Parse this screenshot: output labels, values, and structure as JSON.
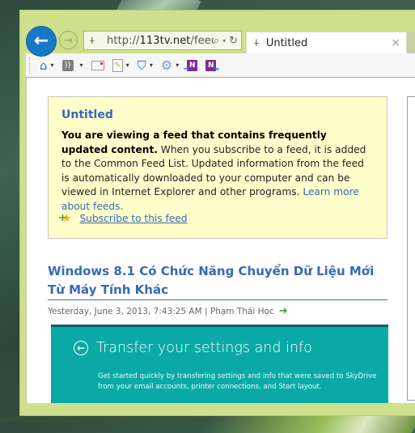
{
  "browser": {
    "address_bar": {
      "url_prefix": "http://",
      "url_domain": "113tv.net",
      "url_path": "/feed/"
    },
    "tab": {
      "title": "Untitled",
      "close_label": "×"
    },
    "nav": {
      "back_label": "←",
      "forward_label": "→"
    },
    "icons": {
      "pulse": "⍭",
      "search": "⌕",
      "dropdown": "▾",
      "refresh": "↻",
      "home": "⌂",
      "rss": "))",
      "shield": "⛉",
      "gear": "⚙",
      "onenote": "N"
    }
  },
  "feed": {
    "title": "Untitled",
    "intro_bold": "You are viewing a feed that contains frequently updated content.",
    "intro_text": " When you subscribe to a feed, it is added to the Common Feed List. Updated information from the feed is automatically downloaded to your computer and can be viewed in Internet Explorer and other programs. ",
    "learn_more": "Learn more about feeds.",
    "subscribe": "Subscribe to this feed"
  },
  "article": {
    "title": "Windows 8.1 Có Chức Năng Chuyển Dữ Liệu Mới Từ Máy Tính Khác",
    "meta": "Yesterday, June 3, 2013, 7:43:25 AM | Phạm Thái Học",
    "image": {
      "heading": "Transfer your settings and info",
      "description": "Get started quickly by transfering settings and info that were saved to SkyDrive from your email accounts, printer connections, and Start layout."
    }
  },
  "colors": {
    "window_frame": "#cfe08c",
    "back_button": "#1878c6",
    "link_blue": "#3669b5",
    "feed_box_bg": "#ffffcc",
    "image_teal": "#0aa9a6"
  }
}
